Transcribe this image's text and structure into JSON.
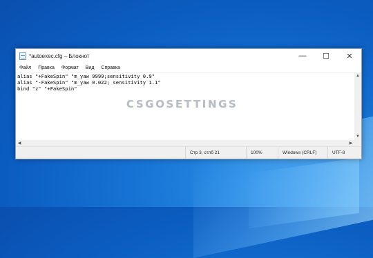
{
  "window": {
    "title": "*autoexec.cfg – Блокнот",
    "controls": {
      "minimize": "—",
      "maximize": "☐",
      "close": "✕"
    }
  },
  "menu": {
    "items": [
      "Файл",
      "Правка",
      "Формат",
      "Вид",
      "Справка"
    ]
  },
  "editor": {
    "lines": [
      "alias \"+FakeSpin\" \"m_yaw 9999;sensitivity 0.9\"",
      "alias \"-FakeSpin\" \"m_yaw 0.022; sensitivity 1.1\"",
      "bind \"z\" \"+FakeSpin\""
    ]
  },
  "watermark": "CSGOSETTINGS",
  "statusbar": {
    "position": "Стр 3, стлб 21",
    "zoom": "100%",
    "line_endings": "Windows (CRLF)",
    "encoding": "UTF-8"
  },
  "icons": {
    "app": "notepad-icon",
    "scroll_up": "▲",
    "scroll_down": "▼",
    "scroll_left": "◀",
    "scroll_right": "▶"
  },
  "colors": {
    "desktop": "#0b5cc0",
    "window_bg": "#ffffff",
    "statusbar_bg": "#f0f0f0"
  }
}
